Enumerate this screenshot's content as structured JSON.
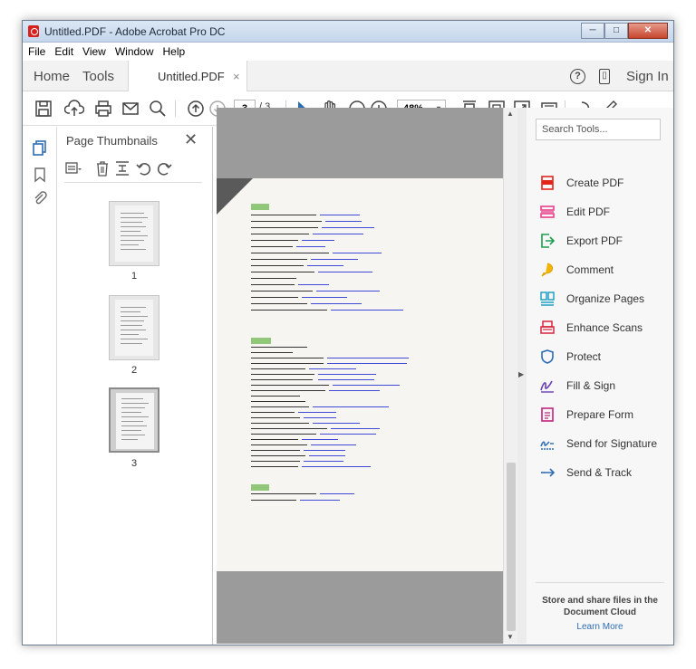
{
  "window": {
    "title": "Untitled.PDF - Adobe Acrobat Pro DC",
    "min": "─",
    "max": "□",
    "close": "✕"
  },
  "menu": [
    "File",
    "Edit",
    "View",
    "Window",
    "Help"
  ],
  "tabs": {
    "home": "Home",
    "tools": "Tools",
    "doc": "Untitled.PDF",
    "doc_close": "×",
    "help": "?",
    "mobile": "▯",
    "signin": "Sign In"
  },
  "toolbar": {
    "page_current": "3",
    "page_total": "/ 3",
    "zoom": "48%",
    "zoom_caret": "▾"
  },
  "thumbnails": {
    "title": "Page Thumbnails",
    "close": "✕",
    "pages": [
      "1",
      "2",
      "3"
    ],
    "selected": "3"
  },
  "tools_panel": {
    "search_placeholder": "Search Tools...",
    "items": [
      {
        "label": "Create PDF",
        "icon": "create-pdf-icon",
        "color": "#e1251b"
      },
      {
        "label": "Edit PDF",
        "icon": "edit-pdf-icon",
        "color": "#e8408b"
      },
      {
        "label": "Export PDF",
        "icon": "export-pdf-icon",
        "color": "#1b9e4e"
      },
      {
        "label": "Comment",
        "icon": "comment-icon",
        "color": "#f5b400"
      },
      {
        "label": "Organize Pages",
        "icon": "organize-pages-icon",
        "color": "#21a0c5"
      },
      {
        "label": "Enhance Scans",
        "icon": "enhance-scans-icon",
        "color": "#d8243b"
      },
      {
        "label": "Protect",
        "icon": "protect-icon",
        "color": "#2d6db5"
      },
      {
        "label": "Fill & Sign",
        "icon": "fill-sign-icon",
        "color": "#6a3fb5"
      },
      {
        "label": "Prepare Form",
        "icon": "prepare-form-icon",
        "color": "#c1257c"
      },
      {
        "label": "Send for Signature",
        "icon": "send-signature-icon",
        "color": "#2d6db5"
      },
      {
        "label": "Send & Track",
        "icon": "send-track-icon",
        "color": "#2d6db5"
      }
    ],
    "cloud_text": "Store and share files in the Document Cloud",
    "learn_more": "Learn More"
  }
}
